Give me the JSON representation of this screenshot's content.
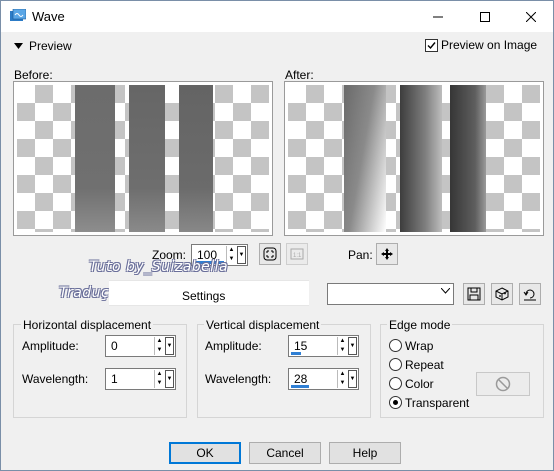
{
  "window": {
    "title": "Wave"
  },
  "preview": {
    "toggle_label": "Preview",
    "preview_on_image_label": "Preview on Image",
    "preview_on_image_checked": true
  },
  "before_label": "Before:",
  "after_label": "After:",
  "zoom": {
    "label": "Zoom:",
    "value": "100"
  },
  "pan": {
    "label": "Pan:"
  },
  "watermark": {
    "line1": "Tuto by_Suizabella",
    "line2": "Tradução by_Marcia Novaes"
  },
  "settings": {
    "label": "Settings",
    "preset_value": ""
  },
  "horizontal": {
    "title": "Horizontal displacement",
    "amplitude_label": "Amplitude:",
    "amplitude_value": "0",
    "wavelength_label": "Wavelength:",
    "wavelength_value": "1"
  },
  "vertical": {
    "title": "Vertical displacement",
    "amplitude_label": "Amplitude:",
    "amplitude_value": "15",
    "wavelength_label": "Wavelength:",
    "wavelength_value": "28"
  },
  "edge_mode": {
    "title": "Edge mode",
    "options": [
      "Wrap",
      "Repeat",
      "Color",
      "Transparent"
    ],
    "selected": "Transparent"
  },
  "buttons": {
    "ok": "OK",
    "cancel": "Cancel",
    "help": "Help"
  },
  "icons": [
    "wave-app-icon",
    "minimize-icon",
    "maximize-icon",
    "close-icon",
    "triangle-down-icon",
    "checkmark-icon",
    "pan-move-icon",
    "zoom-fit-icon",
    "actual-size-icon",
    "save-preset-icon",
    "randomize-icon",
    "reset-icon",
    "no-symbol-icon"
  ],
  "colors": {
    "accent": "#0078d7",
    "edit_underline": "#2f7fd4",
    "checker": "#c4c4c4"
  }
}
